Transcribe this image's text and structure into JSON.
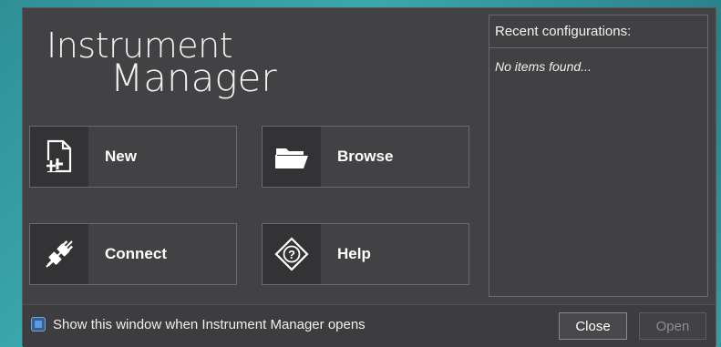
{
  "logo": {
    "line1": "Instrument",
    "line2": "Manager"
  },
  "tiles": {
    "new": {
      "label": "New",
      "icon": "new-file-icon"
    },
    "browse": {
      "label": "Browse",
      "icon": "folder-open-icon"
    },
    "connect": {
      "label": "Connect",
      "icon": "plug-connect-icon"
    },
    "help": {
      "label": "Help",
      "icon": "help-diamond-icon"
    }
  },
  "recent": {
    "title": "Recent configurations:",
    "empty_text": "No items found..."
  },
  "footer": {
    "checkbox_label": "Show this window when Instrument Manager opens",
    "checkbox_checked": true,
    "close_label": "Close",
    "open_label": "Open"
  },
  "colors": {
    "window_bg": "#424244",
    "accent": "#5b9be3",
    "text": "#ffffff"
  }
}
